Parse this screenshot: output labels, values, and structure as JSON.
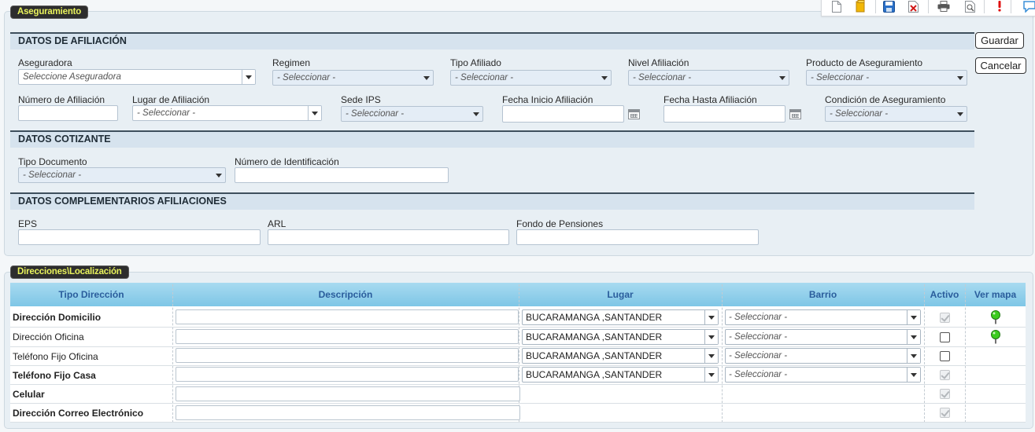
{
  "panel1": {
    "tab": "Aseguramiento"
  },
  "toolbar": {
    "icons": [
      "new-document-icon",
      "folder-icon",
      "save-icon",
      "delete-document-icon",
      "print-icon",
      "preview-icon",
      "alert-icon",
      "comment-icon"
    ]
  },
  "actions": {
    "save": "Guardar",
    "cancel": "Cancelar"
  },
  "afiliacion": {
    "title": "DATOS DE AFILIACIÓN",
    "aseguradora": {
      "label": "Aseguradora",
      "placeholder": "Seleccione Aseguradora"
    },
    "regimen": {
      "label": "Regimen",
      "value": "- Seleccionar -"
    },
    "tipo_afiliado": {
      "label": "Tipo Afiliado",
      "value": "- Seleccionar -"
    },
    "nivel_afiliacion": {
      "label": "Nivel Afiliación",
      "value": "- Seleccionar -"
    },
    "producto": {
      "label": "Producto de Aseguramiento",
      "value": "- Seleccionar -"
    },
    "numero_afiliacion": {
      "label": "Número de Afiliación",
      "value": ""
    },
    "lugar_afiliacion": {
      "label": "Lugar de Afiliación",
      "value": "- Seleccionar -"
    },
    "sede_ips": {
      "label": "Sede IPS",
      "value": "- Seleccionar -"
    },
    "fecha_inicio": {
      "label": "Fecha Inicio Afiliación",
      "value": ""
    },
    "fecha_hasta": {
      "label": "Fecha Hasta Afiliación",
      "value": ""
    },
    "condicion": {
      "label": "Condición de Aseguramiento",
      "value": "- Seleccionar -"
    }
  },
  "cotizante": {
    "title": "DATOS COTIZANTE",
    "tipo_documento": {
      "label": "Tipo Documento",
      "value": "- Seleccionar -"
    },
    "numero_identificacion": {
      "label": "Número de Identificación",
      "value": ""
    }
  },
  "complementarios": {
    "title": "DATOS COMPLEMENTARIOS AFILIACIONES",
    "eps": {
      "label": "EPS",
      "value": ""
    },
    "arl": {
      "label": "ARL",
      "value": ""
    },
    "fondo_pensiones": {
      "label": "Fondo de Pensiones",
      "value": ""
    }
  },
  "panel2": {
    "tab": "Direcciones\\Localización"
  },
  "table": {
    "headers": [
      "Tipo Dirección",
      "Descripción",
      "Lugar",
      "Barrio",
      "Activo",
      "Ver mapa"
    ],
    "rows": [
      {
        "tipo": "Dirección Domicilio",
        "bold": true,
        "descripcion": "",
        "lugar": "BUCARAMANGA ,SANTANDER",
        "barrio": "- Seleccionar -",
        "activo": "checked-disabled",
        "mapa": true
      },
      {
        "tipo": "Dirección Oficina",
        "bold": false,
        "descripcion": "",
        "lugar": "BUCARAMANGA ,SANTANDER",
        "barrio": "- Seleccionar -",
        "activo": "unchecked",
        "mapa": true
      },
      {
        "tipo": "Teléfono Fijo Oficina",
        "bold": false,
        "descripcion": "",
        "lugar": "BUCARAMANGA ,SANTANDER",
        "barrio": "- Seleccionar -",
        "activo": "unchecked",
        "mapa": false
      },
      {
        "tipo": "Teléfono Fijo Casa",
        "bold": true,
        "descripcion": "",
        "lugar": "BUCARAMANGA ,SANTANDER",
        "barrio": "- Seleccionar -",
        "activo": "checked-disabled",
        "mapa": false
      },
      {
        "tipo": "Celular",
        "bold": true,
        "descripcion": "",
        "lugar": "",
        "barrio": "",
        "activo": "checked-disabled",
        "mapa": false
      },
      {
        "tipo": "Dirección Correo Electrónico",
        "bold": true,
        "descripcion": "",
        "lugar": "",
        "barrio": "",
        "activo": "checked-disabled",
        "mapa": false
      }
    ]
  },
  "colors": {
    "tab_bg": "#2d2d2d",
    "tab_text": "#e8f25c",
    "header_blue": "#7ec6e6",
    "header_text": "#2a5d9c",
    "map_pin": "#3ccc1e"
  }
}
